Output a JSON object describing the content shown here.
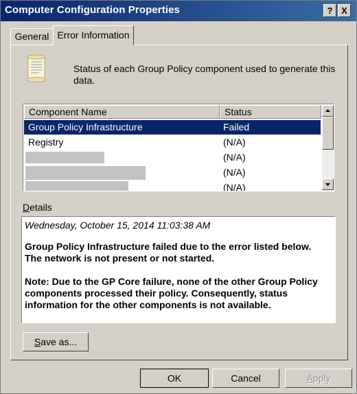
{
  "window": {
    "title": "Computer Configuration Properties",
    "help_button": "?",
    "close_button": "X"
  },
  "tabs": [
    {
      "label": "General"
    },
    {
      "label": "Error Information"
    }
  ],
  "error_tab": {
    "description": "Status of each Group Policy component used to generate this data.",
    "columns": {
      "name": "Component Name",
      "status": "Status"
    },
    "rows": [
      {
        "name": "Group Policy Infrastructure",
        "status": "Failed"
      },
      {
        "name": "Registry",
        "status": "(N/A)"
      },
      {
        "name": "",
        "status": "(N/A)"
      },
      {
        "name": "",
        "status": "(N/A)"
      },
      {
        "name": "",
        "status": "(N/A)"
      }
    ],
    "details_label_prefix": "",
    "details_label_access": "D",
    "details_label_rest": "etails",
    "details": {
      "timestamp": "Wednesday, October 15, 2014 11:03:38 AM",
      "message_line1": "Group Policy Infrastructure failed due to the error listed below.",
      "message_line2": "The network is not present or not started.",
      "note": "Note:  Due to the GP Core failure, none of the other Group Policy components processed their policy.  Consequently, status information for the other components is not available."
    },
    "save_as_access": "S",
    "save_as_rest": "ave as..."
  },
  "footer": {
    "ok": "OK",
    "cancel": "Cancel",
    "apply_access": "A",
    "apply_rest": "pply"
  },
  "colors": {
    "selection": "#0a246a",
    "titlebar_start": "#0a246a",
    "titlebar_end": "#3a6ea5",
    "dialog_face": "#d4d0c8"
  }
}
